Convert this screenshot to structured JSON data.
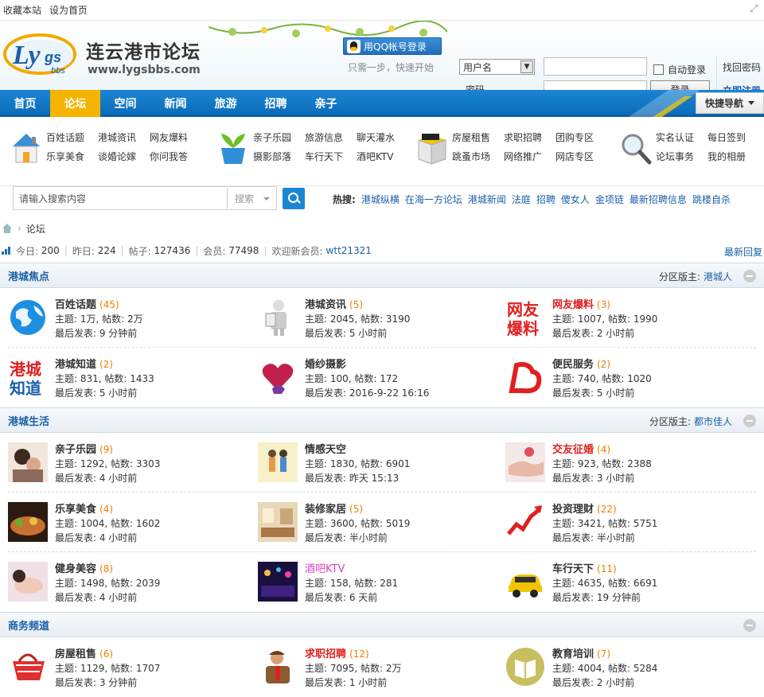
{
  "topbar": {
    "bookmark": "收藏本站",
    "homepage": "设为首页"
  },
  "header": {
    "site_title": "连云港市论坛",
    "site_url": "www.lygsbbs.com",
    "logo_text": "Lygs bbs",
    "qq_login": "用QQ帐号登录",
    "qq_tip": "只需一步，快速开始",
    "username_select": "用户名",
    "password_label": "密码",
    "auto_login": "自动登录",
    "login_btn": "登录",
    "find_pwd": "找回密码",
    "register": "立即注册"
  },
  "nav": {
    "items": [
      "首页",
      "论坛",
      "空间",
      "新闻",
      "旅游",
      "招聘",
      "亲子"
    ],
    "active_index": 1,
    "quick_nav": "快捷导航"
  },
  "categories": [
    {
      "icon": "house-icon",
      "links": [
        "百姓话题",
        "港城资讯",
        "网友爆料",
        "乐享美食",
        "谈婚论嫁",
        "你问我答"
      ]
    },
    {
      "icon": "plant-icon",
      "links": [
        "亲子乐园",
        "旅游信息",
        "聊天灌水",
        "摄影部落",
        "车行天下",
        "酒吧KTV"
      ]
    },
    {
      "icon": "box-icon",
      "links": [
        "房屋租售",
        "求职招聘",
        "团购专区",
        "跳蚤市场",
        "网络推广",
        "网店专区"
      ]
    },
    {
      "icon": "magnifier-icon",
      "links": [
        "实名认证",
        "每日签到",
        "论坛事务",
        "我的相册"
      ]
    }
  ],
  "search": {
    "placeholder": "请输入搜索内容",
    "type": "搜索",
    "hot_label": "热搜:",
    "hot": [
      "港城纵横",
      "在海一方论坛",
      "港城新闻",
      "法庭",
      "招聘",
      "傻女人",
      "金项链",
      "最新招聘信息",
      "跳楼自杀"
    ]
  },
  "breadcrumb": {
    "current": "论坛"
  },
  "stats": {
    "today_label": "今日:",
    "today": "200",
    "yesterday_label": "昨日:",
    "yesterday": "224",
    "posts_label": "帖子:",
    "posts": "127436",
    "members_label": "会员:",
    "members": "77498",
    "welcome_label": "欢迎新会员:",
    "newest_member": "wtt21321",
    "latest_reply": "最新回复"
  },
  "sections": [
    {
      "title": "港城焦点",
      "moderator_label": "分区版主:",
      "moderator": "港城人",
      "rows": [
        [
          {
            "name": "百姓话题",
            "count": "(45)",
            "style": "normal",
            "icon": "globe-icon",
            "threads": "主题: 1万, 帖数: 2万",
            "last": "最后发表: 9 分钟前"
          },
          {
            "name": "港城资讯",
            "count": "(5)",
            "style": "normal",
            "icon": "reporter-icon",
            "threads": "主题: 2045, 帖数: 3190",
            "last": "最后发表: 5 小时前"
          },
          {
            "name": "网友爆料",
            "count": "(3)",
            "style": "red",
            "icon": "baoliao-icon",
            "threads": "主题: 1007, 帖数: 1990",
            "last": "最后发表: 2 小时前"
          }
        ],
        [
          {
            "name": "港城知道",
            "count": "(2)",
            "style": "normal",
            "icon": "zhidao-icon",
            "threads": "主题: 831, 帖数: 1433",
            "last": "最后发表: 5 小时前"
          },
          {
            "name": "婚纱摄影",
            "count": "",
            "style": "normal",
            "icon": "heart-icon",
            "threads": "主题: 100, 帖数: 172",
            "last": "最后发表: 2016-9-22 16:16"
          },
          {
            "name": "便民服务",
            "count": "(2)",
            "style": "normal",
            "icon": "service-icon",
            "threads": "主题: 740, 帖数: 1020",
            "last": "最后发表: 5 小时前"
          }
        ]
      ]
    },
    {
      "title": "港城生活",
      "moderator_label": "分区版主:",
      "moderator": "都市佳人",
      "rows": [
        [
          {
            "name": "亲子乐园",
            "count": "(9)",
            "style": "normal",
            "icon": "family-icon",
            "threads": "主题: 1292, 帖数: 3303",
            "last": "最后发表: 4 小时前"
          },
          {
            "name": "情感天空",
            "count": "",
            "style": "normal",
            "icon": "couple-icon",
            "threads": "主题: 1830, 帖数: 6901",
            "last": "最后发表: 昨天 15:13"
          },
          {
            "name": "交友征婚",
            "count": "(4)",
            "style": "red",
            "icon": "hands-icon",
            "threads": "主题: 923, 帖数: 2388",
            "last": "最后发表: 3 小时前"
          }
        ],
        [
          {
            "name": "乐享美食",
            "count": "(4)",
            "style": "normal",
            "icon": "food-icon",
            "threads": "主题: 1004, 帖数: 1602",
            "last": "最后发表: 4 小时前"
          },
          {
            "name": "装修家居",
            "count": "(5)",
            "style": "normal",
            "icon": "room-icon",
            "threads": "主题: 3600, 帖数: 5019",
            "last": "最后发表: 半小时前"
          },
          {
            "name": "投资理财",
            "count": "(22)",
            "style": "normal",
            "icon": "chart-up-icon",
            "threads": "主题: 3421, 帖数: 5751",
            "last": "最后发表: 半小时前"
          }
        ],
        [
          {
            "name": "健身美容",
            "count": "(8)",
            "style": "normal",
            "icon": "spa-icon",
            "threads": "主题: 1498, 帖数: 2039",
            "last": "最后发表: 4 小时前"
          },
          {
            "name": "酒吧KTV",
            "count": "",
            "style": "pink",
            "icon": "bar-icon",
            "threads": "主题: 158, 帖数: 281",
            "last": "最后发表: 6 天前"
          },
          {
            "name": "车行天下",
            "count": "(11)",
            "style": "normal",
            "icon": "taxi-icon",
            "threads": "主题: 4635, 帖数: 6691",
            "last": "最后发表: 19 分钟前"
          }
        ]
      ]
    },
    {
      "title": "商务频道",
      "moderator_label": "",
      "moderator": "",
      "rows": [
        [
          {
            "name": "房屋租售",
            "count": "(6)",
            "style": "normal",
            "icon": "basket-icon",
            "threads": "主题: 1129, 帖数: 1707",
            "last": "最后发表: 3 分钟前"
          },
          {
            "name": "求职招聘",
            "count": "(12)",
            "style": "red",
            "icon": "worker-icon",
            "threads": "主题: 7095, 帖数: 2万",
            "last": "最后发表: 1 小时前"
          },
          {
            "name": "教育培训",
            "count": "(7)",
            "style": "normal",
            "icon": "book-icon",
            "threads": "主题: 4004, 帖数: 5284",
            "last": "最后发表: 2 小时前"
          }
        ]
      ]
    }
  ]
}
